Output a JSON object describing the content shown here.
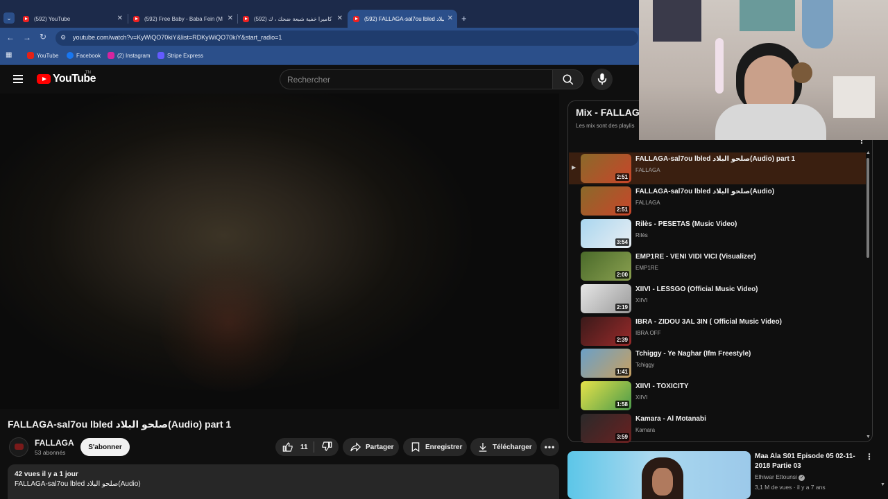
{
  "browser": {
    "tabs": [
      {
        "title": "(592) YouTube",
        "active": false
      },
      {
        "title": "(592) Free Baby - Baba Fein (M",
        "active": false
      },
      {
        "title": "(592) كاميرا خفية شبعة ضحك ، ك",
        "active": false
      },
      {
        "title": "(592) FALLAGA-sal7ou lbled صلحو البلاد",
        "active": true
      }
    ],
    "new_tab": "+",
    "url": "youtube.com/watch?v=KyWiQO70kiY&list=RDKyWiQO70kiY&start_radio=1",
    "bookmarks": [
      {
        "label": "YouTube",
        "color": "#e62117"
      },
      {
        "label": "Facebook",
        "color": "#1877f2"
      },
      {
        "label": "(2) Instagram",
        "color": "#d6249f"
      },
      {
        "label": "Stripe Express",
        "color": "#635bff"
      }
    ]
  },
  "youtube": {
    "logo_text": "YouTube",
    "region": "TN",
    "search_placeholder": "Rechercher"
  },
  "video": {
    "title": "FALLAGA-sal7ou lbled صلحو البلاد(Audio) part 1",
    "channel": "FALLAGA",
    "subscribers": "53 abonnés",
    "subscribe_label": "S'abonner",
    "likes": "11",
    "share_label": "Partager",
    "save_label": "Enregistrer",
    "download_label": "Télécharger",
    "views_date": "42 vues  il y a 1 jour",
    "description": "FALLAGA-sal7ou lbled صلحو البلاد(Audio)"
  },
  "playlist": {
    "title": "Mix - FALLAGA",
    "subtitle": "Les mix sont des playlis",
    "items": [
      {
        "title": "FALLAGA-sal7ou lbled صلحو البلاد(Audio) part 1",
        "channel": "FALLAGA",
        "duration": "2:51",
        "playing": true,
        "thumb": [
          "#8a6a2a",
          "#c9452a"
        ]
      },
      {
        "title": "FALLAGA-sal7ou lbled صلحو البلاد(Audio)",
        "channel": "FALLAGA",
        "duration": "2:51",
        "playing": false,
        "thumb": [
          "#8a6a2a",
          "#c9452a"
        ]
      },
      {
        "title": "Rilès - PESETAS (Music Video)",
        "channel": "Rilès",
        "duration": "3:54",
        "playing": false,
        "thumb": [
          "#a9d6ef",
          "#e9eef3"
        ]
      },
      {
        "title": "EMP1RE - VENI VIDI VICI (Visualizer)",
        "channel": "EMP1RE",
        "duration": "2:00",
        "playing": false,
        "thumb": [
          "#4a6a2a",
          "#8aa050"
        ]
      },
      {
        "title": "XIIVI - LESSGO (Official Music Video)",
        "channel": "XIIVI",
        "duration": "2:19",
        "playing": false,
        "thumb": [
          "#e6e6e6",
          "#9a9a9a"
        ]
      },
      {
        "title": "IBRA - ZIDOU 3AL 3IN ( Official Music Video)",
        "channel": "IBRA OFF",
        "duration": "2:39",
        "playing": false,
        "thumb": [
          "#3a1a1a",
          "#9a2a2a"
        ]
      },
      {
        "title": "Tchiggy - Ye Naghar (Ifm Freestyle)",
        "channel": "Tchiggy",
        "duration": "1:41",
        "playing": false,
        "thumb": [
          "#6aa0c8",
          "#c8a060"
        ]
      },
      {
        "title": "XIIVI - TOXICITY",
        "channel": "XIIVI",
        "duration": "1:58",
        "playing": false,
        "thumb": [
          "#e6e24a",
          "#4a9a4a"
        ]
      },
      {
        "title": "Kamara - Al Motanabi",
        "channel": "Kamara",
        "duration": "3:59",
        "playing": false,
        "thumb": [
          "#2a2a2a",
          "#6a2020"
        ]
      }
    ]
  },
  "recommendation": {
    "title": "Maa Ala S01 Episode 05 02-11-2018 Partie 03",
    "channel": "Elhiwar Ettounsi",
    "meta": "3,1 M de vues · il y a 7 ans"
  }
}
